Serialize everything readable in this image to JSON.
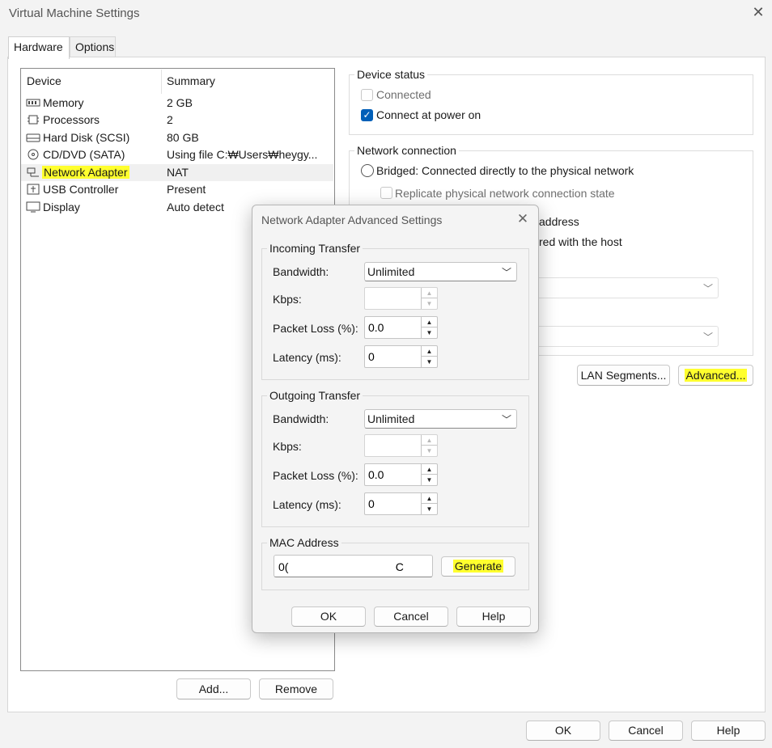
{
  "window": {
    "title": "Virtual Machine Settings",
    "close": "✕"
  },
  "tabs": [
    {
      "label": "Hardware"
    },
    {
      "label": "Options"
    }
  ],
  "device_list": {
    "headers": {
      "device": "Device",
      "summary": "Summary"
    },
    "rows": [
      {
        "name": "Memory",
        "summary": "2 GB",
        "icon": "memory-icon"
      },
      {
        "name": "Processors",
        "summary": "2",
        "icon": "processor-icon"
      },
      {
        "name": "Hard Disk (SCSI)",
        "summary": "80 GB",
        "icon": "hard-disk-icon"
      },
      {
        "name": "CD/DVD (SATA)",
        "summary": "Using file C:₩Users₩heygy...",
        "icon": "cd-dvd-icon"
      },
      {
        "name": "Network Adapter",
        "summary": "NAT",
        "icon": "network-adapter-icon"
      },
      {
        "name": "USB Controller",
        "summary": "Present",
        "icon": "usb-icon"
      },
      {
        "name": "Display",
        "summary": "Auto detect",
        "icon": "display-icon"
      }
    ],
    "add_label": "Add...",
    "remove_label": "Remove"
  },
  "device_status": {
    "title": "Device status",
    "connected_label": "Connected",
    "connect_power_label": "Connect at power on"
  },
  "network_connection": {
    "title": "Network connection",
    "bridged_label": "Bridged: Connected directly to the physical network",
    "replicate_label": "Replicate physical network connection state",
    "partial_1": "address",
    "partial_2": "red with the host",
    "lan_segments_label": "LAN Segments...",
    "advanced_label": "Advanced..."
  },
  "footer": {
    "ok": "OK",
    "cancel": "Cancel",
    "help": "Help"
  },
  "dialog": {
    "title": "Network Adapter Advanced Settings",
    "close": "✕",
    "incoming": {
      "title": "Incoming Transfer",
      "bandwidth_label": "Bandwidth:",
      "bandwidth_value": "Unlimited",
      "kbps_label": "Kbps:",
      "kbps_value": "",
      "packet_loss_label": "Packet Loss (%):",
      "packet_loss_value": "0.0",
      "latency_label": "Latency (ms):",
      "latency_value": "0"
    },
    "outgoing": {
      "title": "Outgoing Transfer",
      "bandwidth_label": "Bandwidth:",
      "bandwidth_value": "Unlimited",
      "kbps_label": "Kbps:",
      "kbps_value": "",
      "packet_loss_label": "Packet Loss (%):",
      "packet_loss_value": "0.0",
      "latency_label": "Latency (ms):",
      "latency_value": "0"
    },
    "mac": {
      "title": "MAC Address",
      "value": "0(                                  C",
      "generate_label": "Generate"
    },
    "ok": "OK",
    "cancel": "Cancel",
    "help": "Help"
  },
  "colors": {
    "highlight": "#ffff2e",
    "accent": "#005fb8"
  }
}
